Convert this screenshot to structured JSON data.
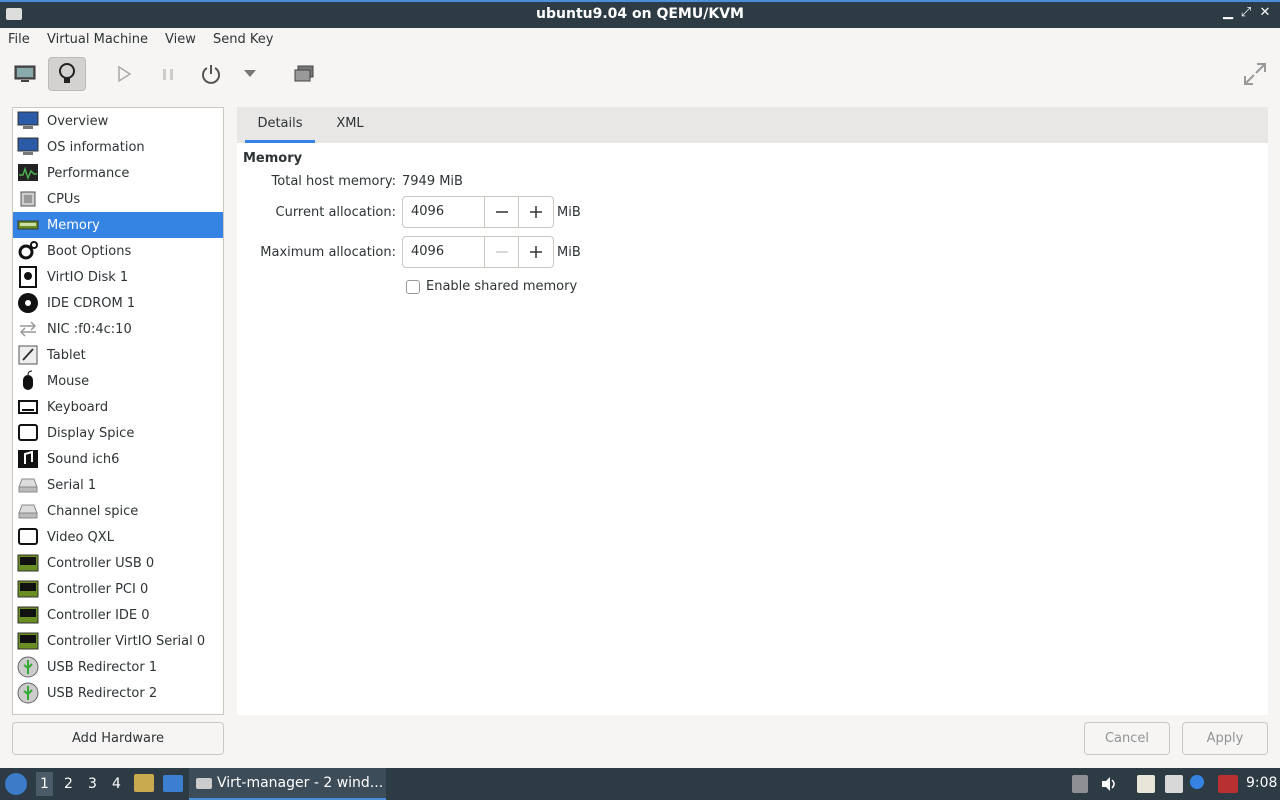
{
  "window": {
    "title": "ubuntu9.04 on QEMU/KVM"
  },
  "menu": [
    "File",
    "Virtual Machine",
    "View",
    "Send Key"
  ],
  "toolbar": {
    "buttons": [
      "console-icon",
      "details-icon",
      "run-icon",
      "pause-icon",
      "power-icon",
      "power-menu-icon",
      "snapshots-icon",
      "fullscreen-icon"
    ],
    "active": "details-icon"
  },
  "sidebar": {
    "items": [
      {
        "label": "Overview",
        "icon": "monitor-icon"
      },
      {
        "label": "OS information",
        "icon": "monitor-icon"
      },
      {
        "label": "Performance",
        "icon": "performance-icon"
      },
      {
        "label": "CPUs",
        "icon": "cpu-icon"
      },
      {
        "label": "Memory",
        "icon": "memory-icon"
      },
      {
        "label": "Boot Options",
        "icon": "gears-icon"
      },
      {
        "label": "VirtIO Disk 1",
        "icon": "disk-icon"
      },
      {
        "label": "IDE CDROM 1",
        "icon": "cdrom-icon"
      },
      {
        "label": "NIC :f0:4c:10",
        "icon": "network-icon"
      },
      {
        "label": "Tablet",
        "icon": "tablet-icon"
      },
      {
        "label": "Mouse",
        "icon": "mouse-icon"
      },
      {
        "label": "Keyboard",
        "icon": "keyboard-icon"
      },
      {
        "label": "Display Spice",
        "icon": "display-icon"
      },
      {
        "label": "Sound ich6",
        "icon": "sound-icon"
      },
      {
        "label": "Serial 1",
        "icon": "serial-icon"
      },
      {
        "label": "Channel spice",
        "icon": "serial-icon"
      },
      {
        "label": "Video QXL",
        "icon": "display-icon"
      },
      {
        "label": "Controller USB 0",
        "icon": "controller-icon"
      },
      {
        "label": "Controller PCI 0",
        "icon": "controller-icon"
      },
      {
        "label": "Controller IDE 0",
        "icon": "controller-icon"
      },
      {
        "label": "Controller VirtIO Serial 0",
        "icon": "controller-icon"
      },
      {
        "label": "USB Redirector 1",
        "icon": "usb-icon"
      },
      {
        "label": "USB Redirector 2",
        "icon": "usb-icon"
      }
    ],
    "selected": "Memory",
    "add_hardware_label": "Add Hardware"
  },
  "tabs": [
    {
      "label": "Details",
      "active": true
    },
    {
      "label": "XML",
      "active": false
    }
  ],
  "memory": {
    "section_title": "Memory",
    "total_label": "Total host memory:",
    "total_value": "7949 MiB",
    "current_label": "Current allocation:",
    "current_value": "4096",
    "maximum_label": "Maximum allocation:",
    "maximum_value": "4096",
    "unit": "MiB",
    "shared_label": "Enable shared memory",
    "shared_checked": false
  },
  "buttons": {
    "cancel": "Cancel",
    "apply": "Apply"
  },
  "taskbar": {
    "workspaces": [
      "1",
      "2",
      "3",
      "4"
    ],
    "active_workspace": "1",
    "task_label": "Virt-manager - 2 wind...",
    "clock": "9:08"
  },
  "colors": {
    "accent": "#3584e4",
    "panel": "#2d3b45"
  }
}
